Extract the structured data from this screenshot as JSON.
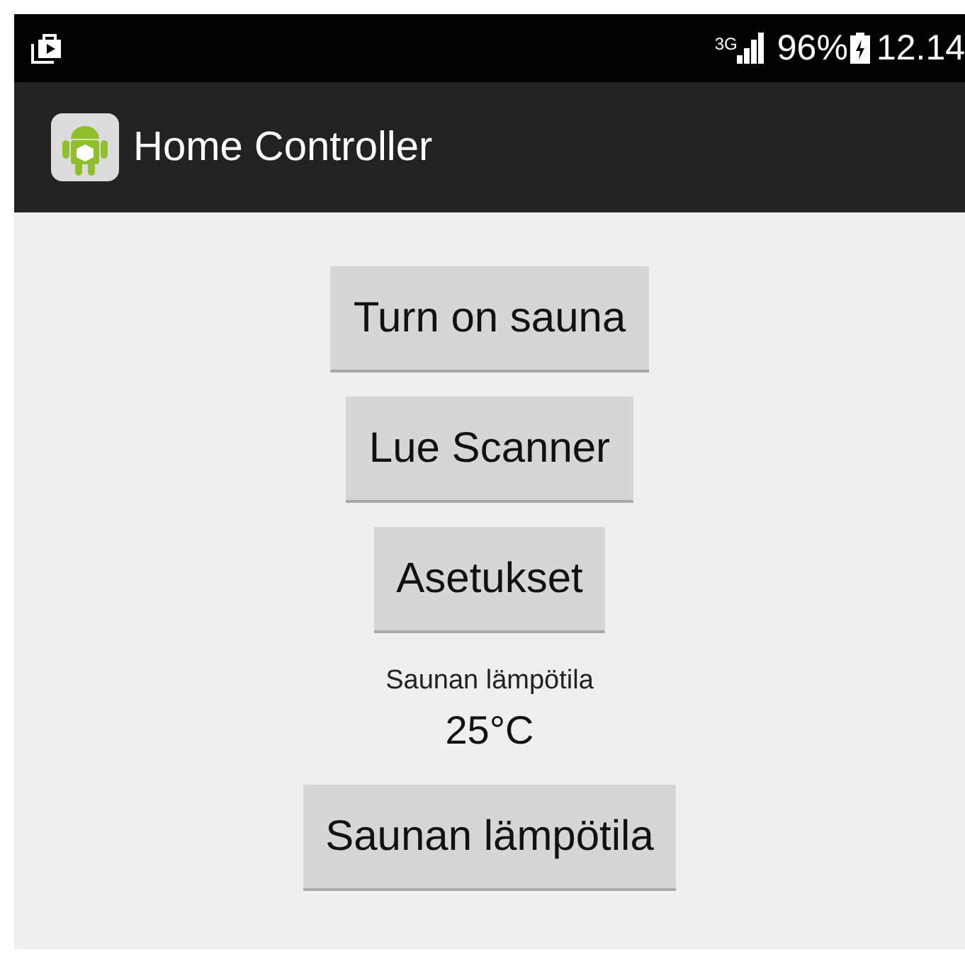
{
  "status_bar": {
    "network": "3G",
    "battery": "96%",
    "time": "12.14"
  },
  "app_bar": {
    "title": "Home Controller"
  },
  "content": [
    {
      "kind": "button",
      "label": "Turn on sauna"
    },
    {
      "kind": "button",
      "label": "Lue Scanner"
    },
    {
      "kind": "button",
      "label": "Asetukset"
    },
    {
      "kind": "caption",
      "label": "Saunan lämpötila"
    },
    {
      "kind": "reading",
      "label": "25°C"
    },
    {
      "kind": "button",
      "label": "Saunan lämpötila"
    }
  ]
}
